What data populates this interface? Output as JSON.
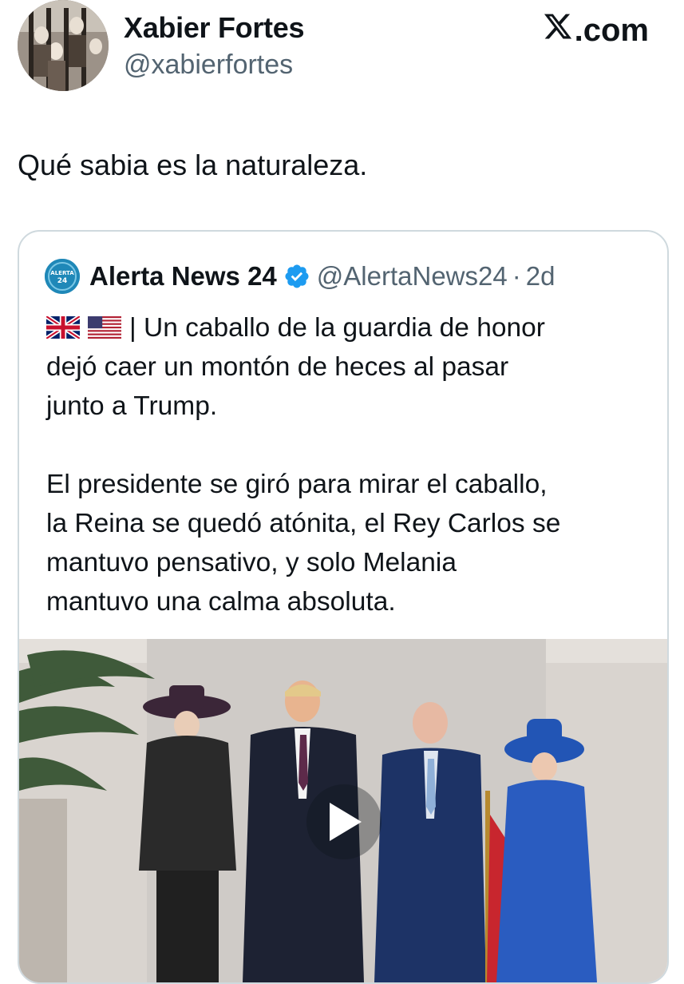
{
  "author": {
    "name": "Xabier Fortes",
    "handle": "@xabierfortes"
  },
  "site": {
    "logo_icon": "x-logo-icon",
    "domain": ".com"
  },
  "tweet": {
    "text": "Qué sabia es la naturaleza."
  },
  "quoted": {
    "name": "Alerta News 24",
    "verified_icon": "verified-badge-icon",
    "handle": "@AlertaNews24",
    "separator": "·",
    "time": "2d",
    "flags": [
      "uk-flag-icon",
      "us-flag-icon"
    ],
    "line1": "| Un caballo de la guardia de honor",
    "line2": "dejó caer un montón de heces al pasar",
    "line3": "junto a Trump.",
    "line4": "El presidente se giró para mirar el caballo,",
    "line5": "la Reina se quedó atónita, el Rey Carlos se",
    "line6": "mantuvo pensativo, y solo Melania",
    "line7": "mantuvo una calma absoluta.",
    "media": {
      "type": "video",
      "play_icon": "play-icon"
    }
  },
  "colors": {
    "text": "#0f1419",
    "secondary": "#536471",
    "border": "#cfd9de",
    "verified": "#1d9bf0"
  }
}
